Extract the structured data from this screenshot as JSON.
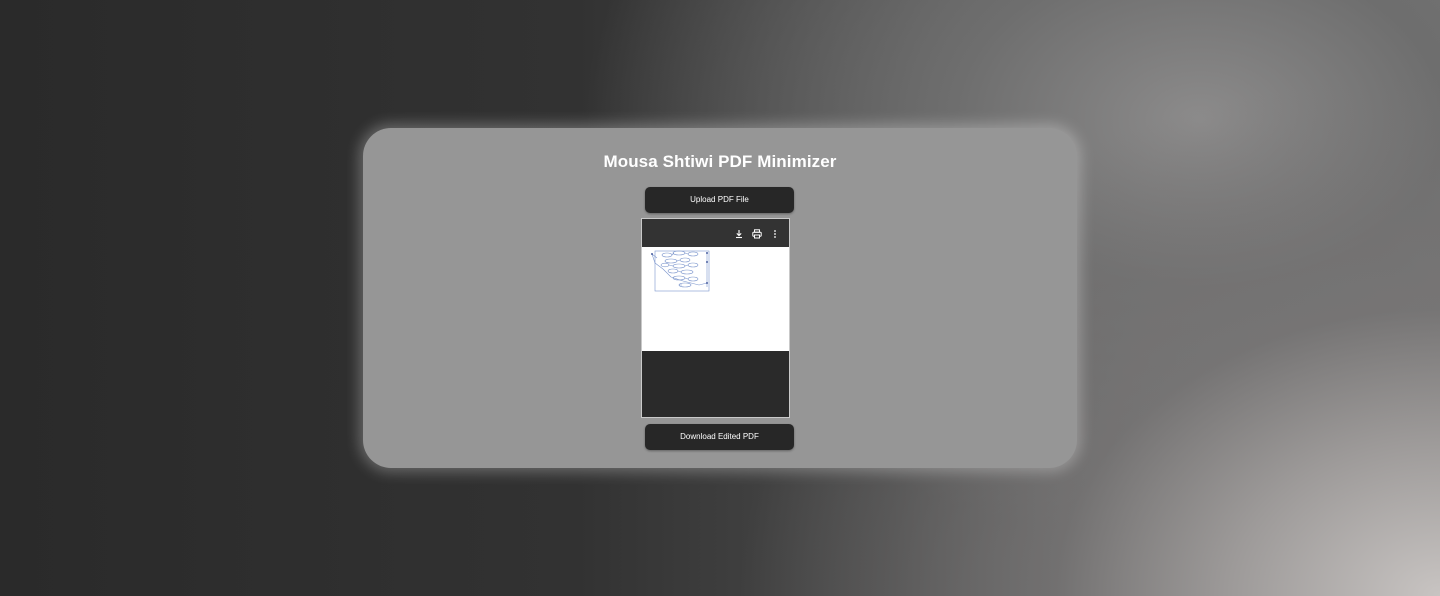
{
  "app": {
    "title": "Mousa Shtiwi PDF Minimizer"
  },
  "actions": {
    "upload_label": "Upload PDF File",
    "download_label": "Download Edited PDF"
  },
  "viewer": {
    "toolbar": {
      "icons": [
        "download-icon",
        "print-icon",
        "more-vert-icon"
      ]
    },
    "page_content": "diagram-thumbnail"
  },
  "colors": {
    "card": "#969696",
    "button": "#272727",
    "viewer_bg": "#2a2a2a",
    "toolbar_bg": "#333333",
    "diagram_stroke": "#6f8fc9"
  }
}
